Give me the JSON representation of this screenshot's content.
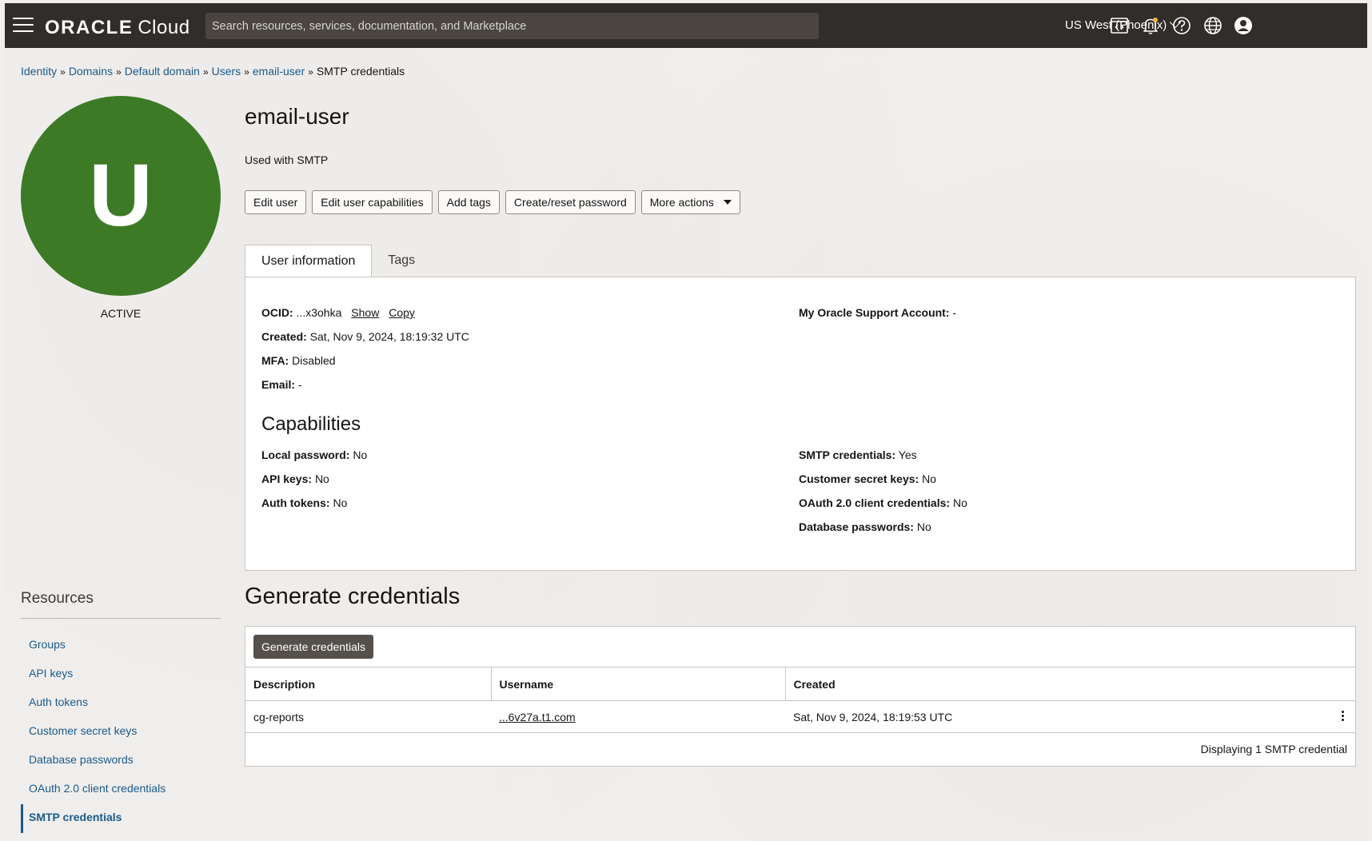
{
  "topbar": {
    "logo_oracle": "ORACLE",
    "logo_cloud": "Cloud",
    "search_placeholder": "Search resources, services, documentation, and Marketplace",
    "region": "US West (Phoenix)"
  },
  "breadcrumb": {
    "items": [
      "Identity",
      "Domains",
      "Default domain",
      "Users",
      "email-user"
    ],
    "separator": "»",
    "current": "SMTP credentials"
  },
  "avatar": {
    "letter": "U",
    "color": "#3c7a26"
  },
  "status": "ACTIVE",
  "user": {
    "name": "email-user",
    "description": "Used with SMTP"
  },
  "actions": {
    "edit_user": "Edit user",
    "edit_capabilities": "Edit user capabilities",
    "add_tags": "Add tags",
    "create_reset_password": "Create/reset password",
    "more_actions": "More actions"
  },
  "tabs": {
    "user_information": "User information",
    "tags": "Tags"
  },
  "info": {
    "ocid_label": "OCID:",
    "ocid_value": "...x3ohka",
    "show": "Show",
    "copy": "Copy",
    "created_label": "Created:",
    "created_value": "Sat, Nov 9, 2024, 18:19:32 UTC",
    "mfa_label": "MFA:",
    "mfa_value": "Disabled",
    "email_label": "Email:",
    "email_value": "-",
    "support_label": "My Oracle Support Account:",
    "support_value": "-"
  },
  "capabilities": {
    "title": "Capabilities",
    "local_password_label": "Local password:",
    "local_password_value": "No",
    "api_keys_label": "API keys:",
    "api_keys_value": "No",
    "auth_tokens_label": "Auth tokens:",
    "auth_tokens_value": "No",
    "smtp_label": "SMTP credentials:",
    "smtp_value": "Yes",
    "customer_secret_label": "Customer secret keys:",
    "customer_secret_value": "No",
    "oauth_label": "OAuth 2.0 client credentials:",
    "oauth_value": "No",
    "db_passwords_label": "Database passwords:",
    "db_passwords_value": "No"
  },
  "resources": {
    "title": "Resources",
    "items": [
      "Groups",
      "API keys",
      "Auth tokens",
      "Customer secret keys",
      "Database passwords",
      "OAuth 2.0 client credentials",
      "SMTP credentials"
    ],
    "active": "SMTP credentials"
  },
  "generate": {
    "title": "Generate credentials",
    "button": "Generate credentials",
    "columns": [
      "Description",
      "Username",
      "Created"
    ],
    "rows": [
      {
        "description": "cg-reports",
        "username": "...6v27a.t1.com",
        "created": "Sat, Nov 9, 2024, 18:19:53 UTC"
      }
    ],
    "footer": "Displaying 1 SMTP credential"
  }
}
